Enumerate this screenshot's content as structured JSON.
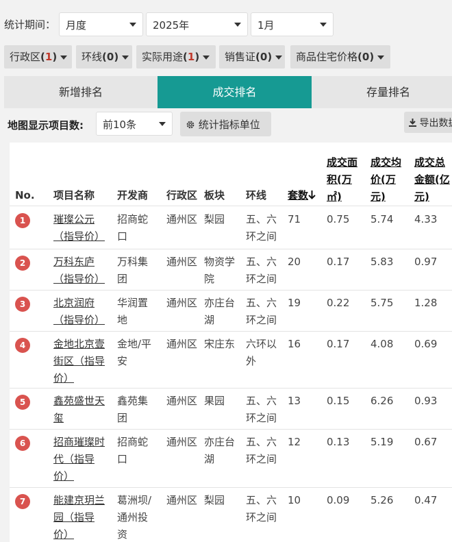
{
  "period": {
    "label": "统计期间：",
    "granularity": "月度",
    "year": "2025年",
    "month": "1月"
  },
  "filters": [
    {
      "name": "行政区",
      "count": "1",
      "count_color": "#c0392b"
    },
    {
      "name": "环线",
      "count": "0",
      "count_color": "#333333"
    },
    {
      "name": "实际用途",
      "count": "1",
      "count_color": "#c0392b"
    },
    {
      "name": "销售证",
      "count": "0",
      "count_color": "#333333"
    },
    {
      "name": "商品住宅价格",
      "count": "0",
      "count_color": "#333333"
    }
  ],
  "tabs": [
    {
      "label": "新增排名",
      "active": false
    },
    {
      "label": "成交排名",
      "active": true
    },
    {
      "label": "存量排名",
      "active": false
    }
  ],
  "map_count": {
    "label": "地图显示项目数:",
    "value": "前10条",
    "indicator_button": "统计指标单位",
    "export_button": "导出数据"
  },
  "colors": {
    "accent": "#169a93",
    "rank_badge": "#d9534f"
  },
  "table": {
    "headers": {
      "no": "No.",
      "name": "项目名称",
      "developer": "开发商",
      "district": "行政区",
      "block": "板块",
      "ring": "环线",
      "units": "套数",
      "area_l1": "成交面",
      "area_l2": "积(万",
      "area_l3": "㎡)",
      "avg_l1": "成交均",
      "avg_l2": "价(万",
      "avg_l3": "元)",
      "total_l1": "成交总",
      "total_l2": "金额(亿",
      "total_l3": "元)"
    },
    "sort_icon": "arrow-down-icon",
    "rows": [
      {
        "rank": "1",
        "name": [
          "璀璨公元",
          "（指导价）"
        ],
        "developer": [
          "招商蛇",
          "口"
        ],
        "district": "通州区",
        "block": [
          "梨园"
        ],
        "ring": [
          "五、六",
          "环之间"
        ],
        "units": "71",
        "area": "0.75",
        "avg": "5.74",
        "total": "4.33"
      },
      {
        "rank": "2",
        "name": [
          "万科东庐",
          "（指导价）"
        ],
        "developer": [
          "万科集",
          "团"
        ],
        "district": "通州区",
        "block": [
          "物资学",
          "院"
        ],
        "ring": [
          "五、六",
          "环之间"
        ],
        "units": "20",
        "area": "0.17",
        "avg": "5.83",
        "total": "0.97"
      },
      {
        "rank": "3",
        "name": [
          "北京润府",
          "（指导价）"
        ],
        "developer": [
          "华润置",
          "地"
        ],
        "district": "通州区",
        "block": [
          "亦庄台",
          "湖"
        ],
        "ring": [
          "五、六",
          "环之间"
        ],
        "units": "19",
        "area": "0.22",
        "avg": "5.75",
        "total": "1.28"
      },
      {
        "rank": "4",
        "name": [
          "金地北京壹",
          "街区（指导",
          "价）"
        ],
        "developer": [
          "金地/平",
          "安"
        ],
        "district": "通州区",
        "block": [
          "宋庄东"
        ],
        "ring": [
          "六环以",
          "外"
        ],
        "units": "16",
        "area": "0.17",
        "avg": "4.08",
        "total": "0.69"
      },
      {
        "rank": "5",
        "name": [
          "鑫苑盛世天",
          "玺"
        ],
        "developer": [
          "鑫苑集",
          "团"
        ],
        "district": "通州区",
        "block": [
          "果园"
        ],
        "ring": [
          "五、六",
          "环之间"
        ],
        "units": "13",
        "area": "0.15",
        "avg": "6.26",
        "total": "0.93"
      },
      {
        "rank": "6",
        "name": [
          "招商璀璨时",
          "代（指导",
          "价）"
        ],
        "developer": [
          "招商蛇",
          "口"
        ],
        "district": "通州区",
        "block": [
          "亦庄台",
          "湖"
        ],
        "ring": [
          "五、六",
          "环之间"
        ],
        "units": "12",
        "area": "0.13",
        "avg": "5.19",
        "total": "0.67"
      },
      {
        "rank": "7",
        "name": [
          "能建京玥兰",
          "园（指导",
          "价）"
        ],
        "developer": [
          "葛洲坝/",
          "通州投",
          "资"
        ],
        "district": "通州区",
        "block": [
          "梨园"
        ],
        "ring": [
          "五、六",
          "环之间"
        ],
        "units": "10",
        "area": "0.09",
        "avg": "5.26",
        "total": "0.47"
      }
    ]
  }
}
